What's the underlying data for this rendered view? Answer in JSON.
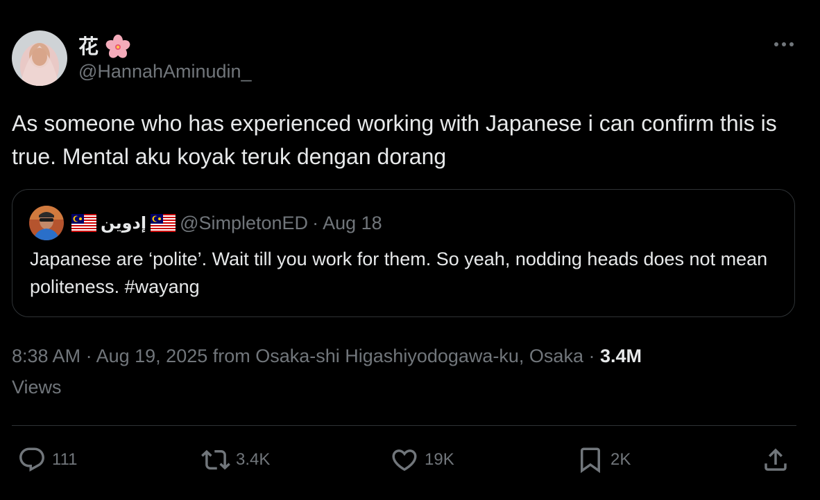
{
  "author": {
    "display_name": "花",
    "handle": "@HannahAminudin_"
  },
  "tweet": {
    "text": "As someone who has experienced working with Japanese i can confirm this is true. Mental aku koyak teruk dengan dorang"
  },
  "quoted_tweet": {
    "display_name": "إدوين",
    "handle": "@SimpletonED",
    "separator": "·",
    "date": "Aug 18",
    "text": "Japanese are ‘polite’. Wait till you work for them. So yeah, nodding heads does not mean politeness. #wayang"
  },
  "meta": {
    "time": "8:38 AM",
    "separator": "·",
    "date_location": "Aug 19, 2025 from Osaka-shi Higashiyodogawa-ku, Osaka",
    "views_count": "3.4M",
    "views_label": "Views"
  },
  "actions": {
    "replies": "111",
    "reposts": "3.4K",
    "likes": "19K",
    "bookmarks": "2K"
  },
  "icons": {
    "display_name_emoji": "cherry-blossom-icon",
    "quote_flags": "malaysia-flag-icon",
    "more": "more-horizontal-icon",
    "reply": "reply-icon",
    "repost": "repost-icon",
    "like": "heart-icon",
    "bookmark": "bookmark-icon",
    "share": "share-icon"
  },
  "colors": {
    "background": "#000000",
    "text_primary": "#e7e9ea",
    "text_secondary": "#71767b",
    "border": "#2f3336"
  }
}
